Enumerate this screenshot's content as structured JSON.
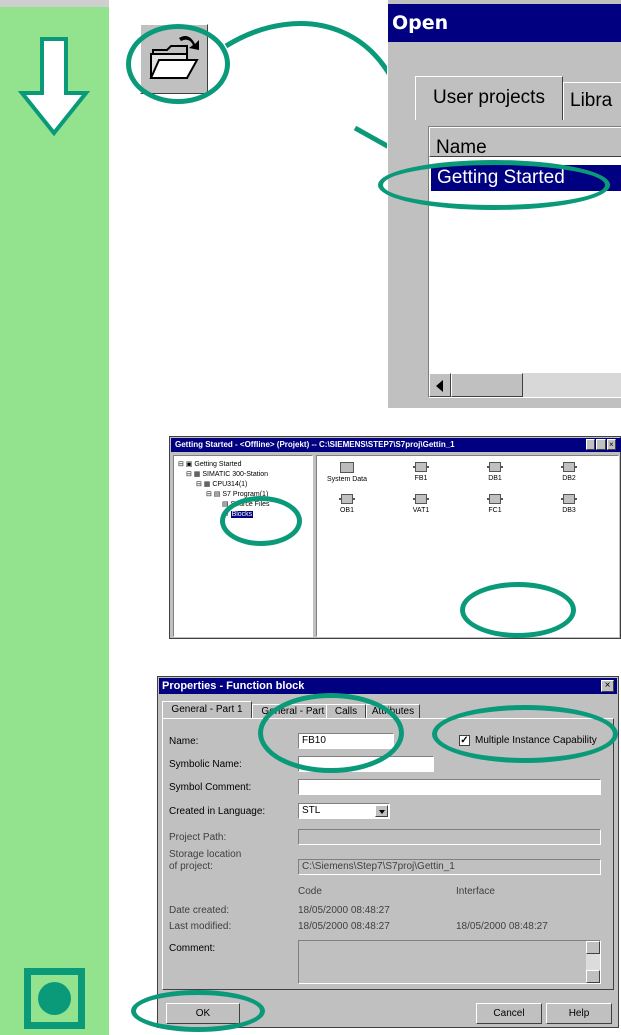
{
  "open_dialog": {
    "title": "Open",
    "tabs": [
      "User projects",
      "Libra"
    ],
    "column_header": "Name",
    "selected_item": "Getting Started"
  },
  "explorer": {
    "title": "Getting Started - <Offline> (Projekt) -- C:\\SIEMENS\\STEP7\\S7proj\\Gettin_1",
    "tree": [
      "Getting Started",
      "SIMATIC 300-Station",
      "CPU314(1)",
      "S7 Program(1)",
      "Source Files",
      "Blocks"
    ],
    "blocks": [
      "System Data",
      "FB1",
      "DB1",
      "DB2",
      "OB1",
      "VAT1",
      "FC1",
      "DB3"
    ]
  },
  "properties": {
    "title": "Properties - Function block",
    "tabs": [
      "General - Part 1",
      "General - Part 2",
      "Calls",
      "Attributes"
    ],
    "name_label": "Name:",
    "name_value": "FB10",
    "multi_instance_label": "Multiple Instance Capability",
    "multi_instance_checked": true,
    "symbolic_name_label": "Symbolic Name:",
    "symbol_comment_label": "Symbol Comment:",
    "language_label": "Created in Language:",
    "language_value": "STL",
    "project_path_label": "Project Path:",
    "storage_label_1": "Storage location",
    "storage_label_2": "of project:",
    "storage_value": "C:\\Siemens\\Step7\\S7proj\\Gettin_1",
    "code_header": "Code",
    "interface_header": "Interface",
    "date_created_label": "Date created:",
    "date_created_code": "18/05/2000  08:48:27",
    "last_modified_label": "Last modified:",
    "last_modified_code": "18/05/2000  08:48:27",
    "last_modified_interface": "18/05/2000  08:48:27",
    "comment_label": "Comment:",
    "ok_label": "OK",
    "cancel_label": "Cancel",
    "help_label": "Help"
  },
  "colors": {
    "sidebar": "#92e28e",
    "highlight": "#0a9a7a",
    "titlebar": "#000080"
  }
}
